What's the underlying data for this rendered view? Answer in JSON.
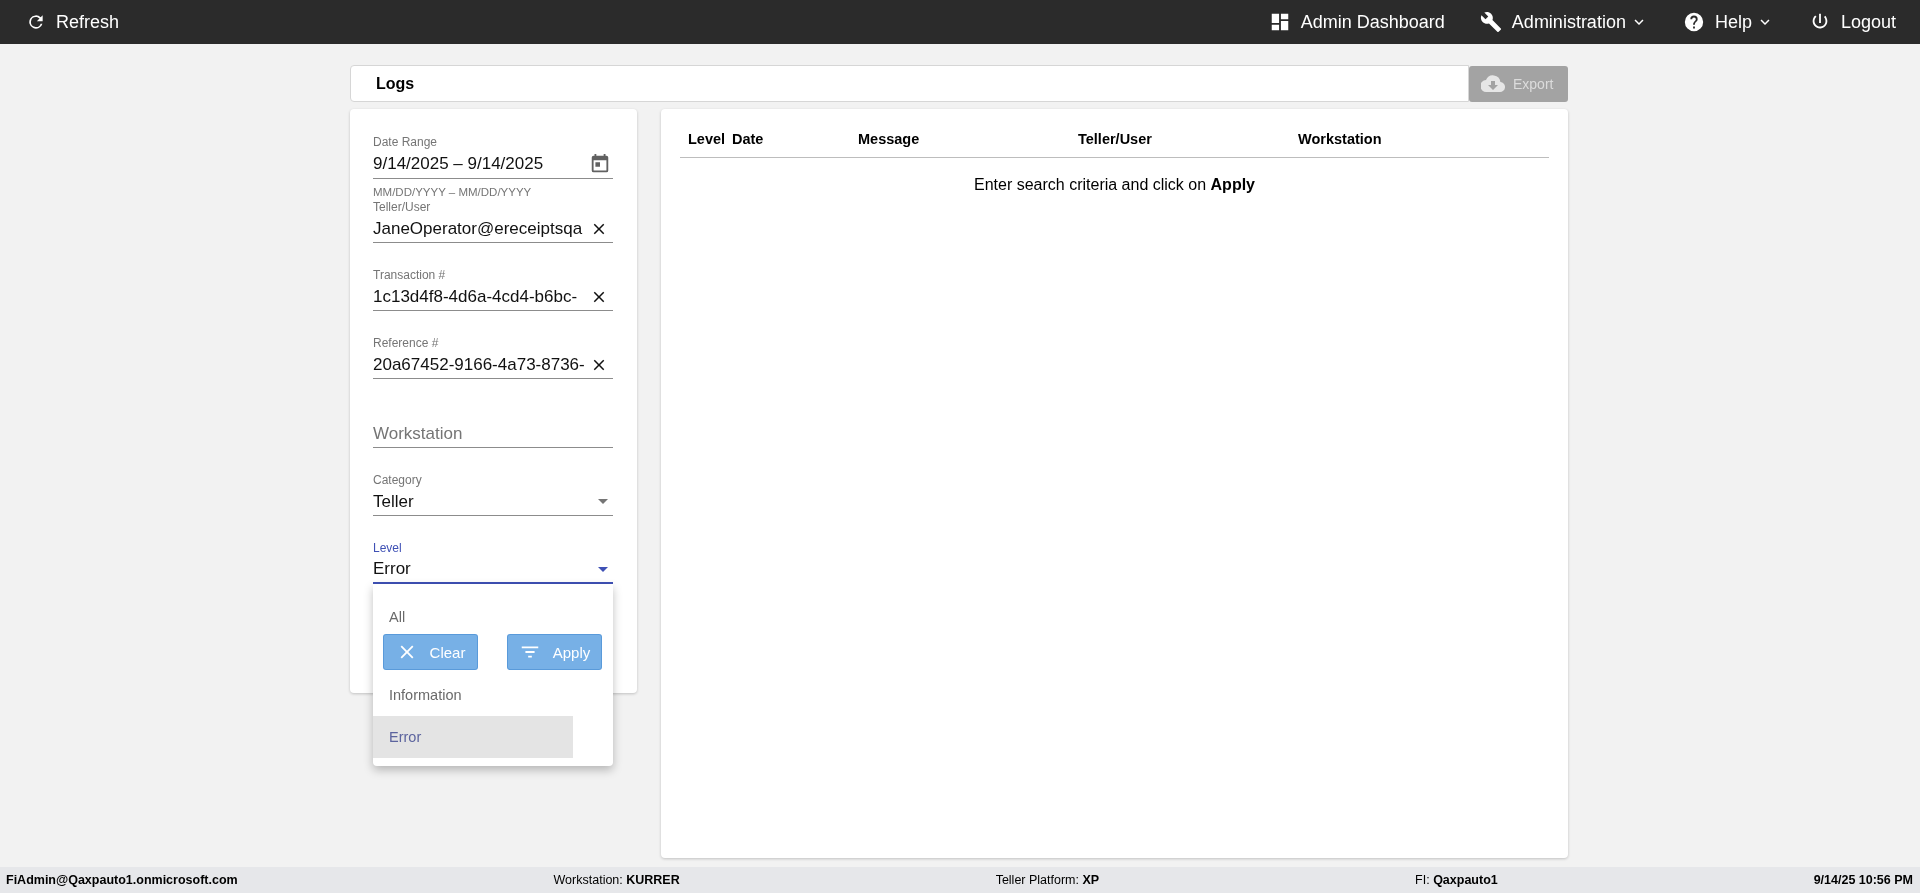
{
  "topbar": {
    "refresh": "Refresh",
    "nav": [
      {
        "kind": "dashboard",
        "label": "Admin Dashboard",
        "has_menu": false
      },
      {
        "kind": "wrench",
        "label": "Administration",
        "has_menu": true
      },
      {
        "kind": "help",
        "label": "Help",
        "has_menu": true
      },
      {
        "kind": "power",
        "label": "Logout",
        "has_menu": false
      }
    ]
  },
  "page": {
    "title": "Logs",
    "export": {
      "label": "Export",
      "disabled": true
    }
  },
  "filters": {
    "fields": [
      {
        "kind": "date",
        "label": "Date Range",
        "value": "9/14/2025 – 9/14/2025",
        "helper": "MM/DD/YYYY – MM/DD/YYYY"
      },
      {
        "kind": "text",
        "label": "Teller/User",
        "value": "JaneOperator@ereceiptsqa",
        "clearable": true
      },
      {
        "kind": "text",
        "label": "Transaction #",
        "value": "1c13d4f8-4d6a-4cd4-b6bc-",
        "clearable": true
      },
      {
        "kind": "text",
        "label": "Reference #",
        "value": "20a67452-9166-4a73-8736-",
        "clearable": true
      },
      {
        "kind": "text",
        "placeholder": "Workstation",
        "clearable": false
      },
      {
        "kind": "select",
        "label": "Category",
        "value": "Teller",
        "focused": false
      },
      {
        "kind": "select",
        "label": "Level",
        "value": "Error",
        "focused": true,
        "options": [
          {
            "label": "All",
            "selected": false
          },
          {
            "label": "Information",
            "selected": false
          },
          {
            "label": "Error",
            "selected": true
          }
        ]
      }
    ],
    "buttons": [
      {
        "kind": "clear",
        "label": "Clear"
      },
      {
        "kind": "apply",
        "label": "Apply"
      }
    ]
  },
  "table": {
    "columns": [
      "Level",
      "Date",
      "Message",
      "Teller/User",
      "Workstation"
    ],
    "empty_message": "Enter search criteria and click on **Apply**"
  },
  "status_bar": [
    {
      "value": "FiAdmin@Qaxpauto1.onmicrosoft.com"
    },
    {
      "label": "Workstation:",
      "value": "KURRER"
    },
    {
      "label": "Teller Platform:",
      "value": "XP"
    },
    {
      "label": "FI:",
      "value": "Qaxpauto1"
    },
    {
      "value": "9/14/25 10:56 PM"
    }
  ]
}
